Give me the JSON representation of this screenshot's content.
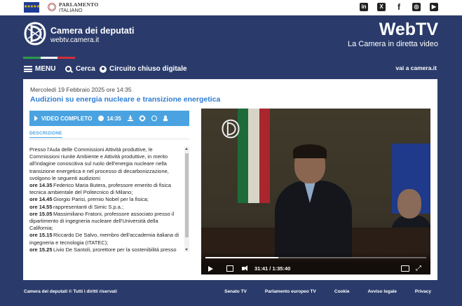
{
  "topbar": {
    "parlamento_line1": "PARLAMENTO",
    "parlamento_line2": "ITALIANO",
    "socials": [
      "linkedin-icon",
      "twitter-icon",
      "facebook-icon",
      "instagram-icon",
      "youtube-icon"
    ]
  },
  "header": {
    "site_title": "Camera dei deputati",
    "site_url": "webtv.camera.it",
    "brand": "WebTV",
    "tagline": "La Camera in diretta video"
  },
  "nav": {
    "menu": "MENU",
    "search": "Cerca",
    "circuit": "Circuito chiuso digitale",
    "go_camera": "vai a camera.it"
  },
  "event": {
    "date": "Mercoledì 19 Febbraio 2025 ore 14:35",
    "title": "Audizioni su energia nucleare e transizione energetica"
  },
  "video_bar": {
    "label": "VIDEO COMPLETO",
    "duration": "14:35"
  },
  "tabs": {
    "description": "DESCRIZIONE"
  },
  "description": {
    "intro": "Presso l'Aula delle Commissioni Attività produttive, le Commissioni riunite Ambiente e Attività produttive, in merito all'indagine conoscitiva sul ruolo dell'energia nucleare nella transizione energetica e nel processo di decarbonizzazione, svolgono le seguenti audizioni:",
    "items": [
      {
        "time": "ore 14.35",
        "text": "Federico Maria Butera, professore emerito di fisica tecnica ambientale del Politecnico di Milano;"
      },
      {
        "time": "ore 14.45",
        "text": "Giorgio Parisi, premio Nobel per la fisica;"
      },
      {
        "time": "ore 14.55",
        "text": "rappresentanti di Simic S.p.a.;"
      },
      {
        "time": "ore 15.05",
        "text": "Massimiliano Fratoni, professore associato presso il dipartimento di ingegneria nucleare dell'Università della California;"
      },
      {
        "time": "ore 15.15",
        "text": "Riccardo De Salvo, membro dell'accademia italiana di ingegneria e tecnologia (ITATEC);"
      },
      {
        "time": "ore 15.25",
        "text": "Livio De Santoli, prorettore per la sostenibilità presso"
      }
    ]
  },
  "player": {
    "current_time": "31:41",
    "separator": "/",
    "total_time": "1:35:40",
    "progress": 0.33
  },
  "footer": {
    "copyright": "Camera dei deputati © Tutti i diritti riservati",
    "links": [
      "Senato TV",
      "Parlamento europeo TV",
      "Cookie",
      "Avviso legale",
      "Privacy"
    ]
  },
  "colors": {
    "navy": "#2a3b6b",
    "accent_blue": "#4aa3e0",
    "title_blue": "#2d7dd2"
  }
}
